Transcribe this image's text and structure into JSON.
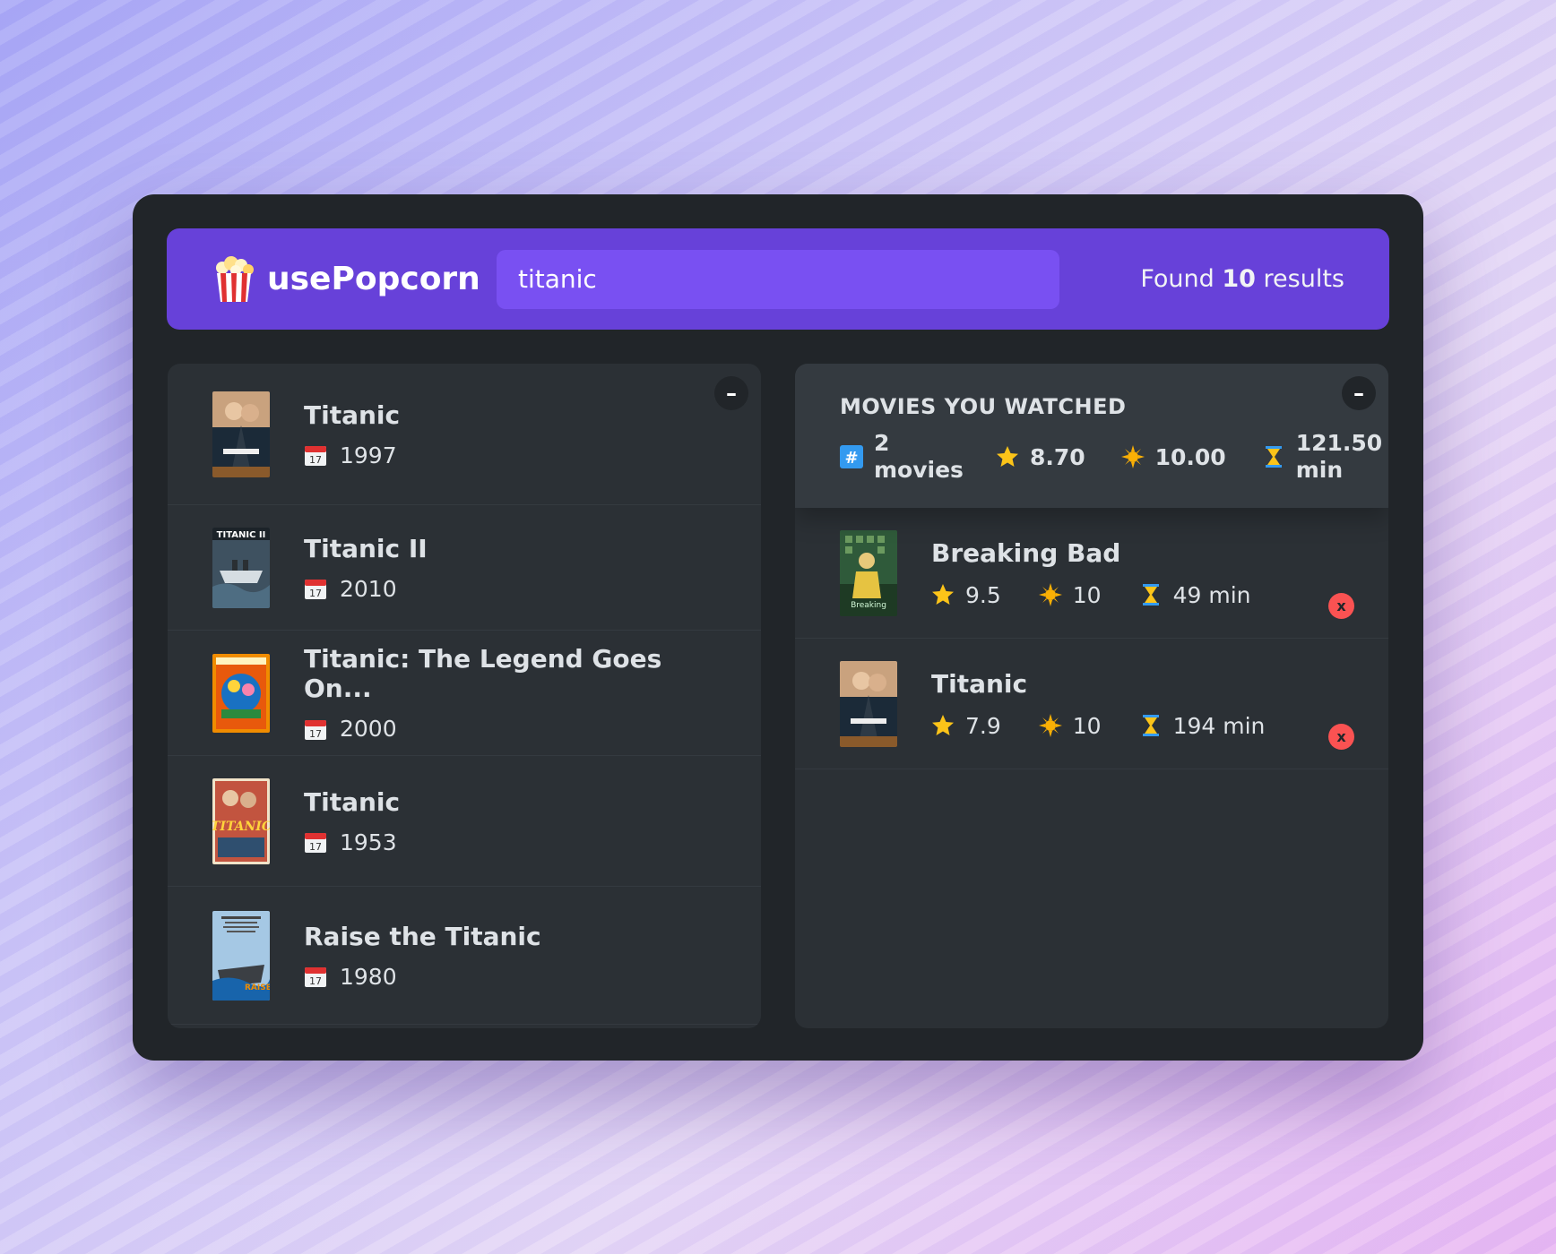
{
  "app": {
    "logo_text": "usePopcorn",
    "search_value": "titanic",
    "results_prefix": "Found",
    "results_count": "10",
    "results_suffix": "results",
    "accent_color": "#6741d9"
  },
  "search_results": {
    "toggle_label": "–",
    "movies": [
      {
        "title": "Titanic",
        "year": "1997",
        "poster_icon": "titanic-1997-poster"
      },
      {
        "title": "Titanic II",
        "year": "2010",
        "poster_icon": "titanic-ii-poster"
      },
      {
        "title": "Titanic: The Legend Goes On...",
        "year": "2000",
        "poster_icon": "titanic-legend-poster"
      },
      {
        "title": "Titanic",
        "year": "1953",
        "poster_icon": "titanic-1953-poster"
      },
      {
        "title": "Raise the Titanic",
        "year": "1980",
        "poster_icon": "raise-the-titanic-poster"
      }
    ]
  },
  "watched": {
    "toggle_label": "–",
    "heading": "MOVIES YOU WATCHED",
    "summary": {
      "count_number": "2",
      "count_unit": "movies",
      "avg_imdb": "8.70",
      "avg_user": "10.00",
      "avg_runtime_number": "121.50",
      "avg_runtime_unit": "min"
    },
    "movies": [
      {
        "title": "Breaking Bad",
        "imdb": "9.5",
        "user": "10",
        "runtime": "49 min",
        "delete_label": "x"
      },
      {
        "title": "Titanic",
        "imdb": "7.9",
        "user": "10",
        "runtime": "194 min",
        "delete_label": "x"
      }
    ]
  }
}
